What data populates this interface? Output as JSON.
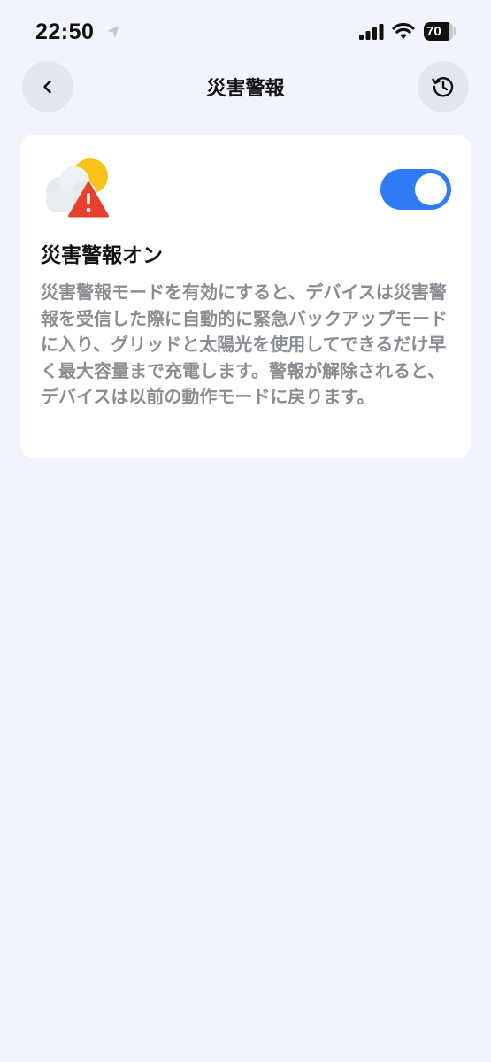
{
  "status_bar": {
    "time": "22:50",
    "battery_level": "70"
  },
  "header": {
    "title": "災害警報",
    "back_icon": "chevron-left-icon",
    "history_icon": "history-icon"
  },
  "card": {
    "icon": "cloud-sun-warning-icon",
    "title": "災害警報オン",
    "toggle_on": true,
    "description": "災害警報モードを有効にすると、デバイスは災害警報を受信した際に自動的に緊急バックアップモードに入り、グリッドと太陽光を使用してできるだけ早く最大容量まで充電します。警報が解除されると、デバイスは以前の動作モードに戻ります。"
  },
  "colors": {
    "background": "#f1f4fd",
    "accent": "#2f7bf5",
    "warning": "#e8402f",
    "sun": "#f8c21a"
  }
}
